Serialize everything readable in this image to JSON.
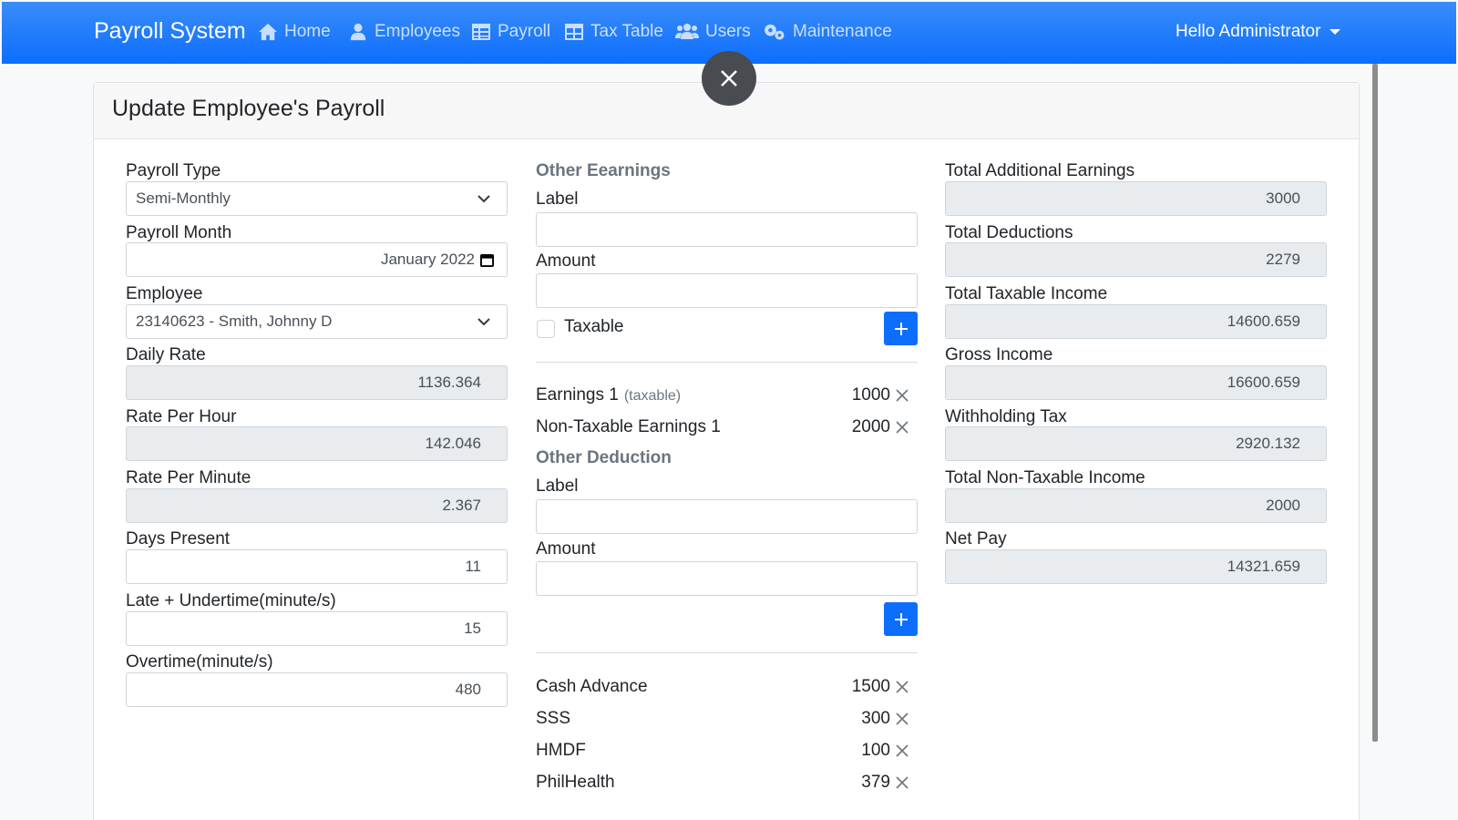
{
  "navbar": {
    "brand": "Payroll System",
    "items": [
      {
        "label": "Home",
        "icon": "home-icon"
      },
      {
        "label": "Employees",
        "icon": "user-icon"
      },
      {
        "label": "Payroll",
        "icon": "table-icon"
      },
      {
        "label": "Tax Table",
        "icon": "table-icon"
      },
      {
        "label": "Users",
        "icon": "users-icon"
      },
      {
        "label": "Maintenance",
        "icon": "gears-icon"
      }
    ],
    "user_greeting": "Hello Administrator"
  },
  "card": {
    "title": "Update Employee's Payroll"
  },
  "left": {
    "payroll_type": {
      "label": "Payroll Type",
      "value": "Semi-Monthly"
    },
    "payroll_month": {
      "label": "Payroll Month",
      "value": "January 2022"
    },
    "employee": {
      "label": "Employee",
      "value": "23140623 - Smith, Johnny D"
    },
    "daily_rate": {
      "label": "Daily Rate",
      "value": "1136.364"
    },
    "rate_per_hour": {
      "label": "Rate Per Hour",
      "value": "142.046"
    },
    "rate_per_minute": {
      "label": "Rate Per Minute",
      "value": "2.367"
    },
    "days_present": {
      "label": "Days Present",
      "value": "11"
    },
    "late_undertime": {
      "label": "Late + Undertime(minute/s)",
      "value": "15"
    },
    "overtime": {
      "label": "Overtime(minute/s)",
      "value": "480"
    }
  },
  "middle": {
    "earnings": {
      "heading": "Other Eearnings",
      "label_label": "Label",
      "amount_label": "Amount",
      "taxable_label": "Taxable",
      "items": [
        {
          "label": "Earnings 1",
          "tag": "(taxable)",
          "amount": "1000"
        },
        {
          "label": "Non-Taxable Earnings 1",
          "tag": "",
          "amount": "2000"
        }
      ]
    },
    "deductions": {
      "heading": "Other Deduction",
      "label_label": "Label",
      "amount_label": "Amount",
      "items": [
        {
          "label": "Cash Advance",
          "amount": "1500"
        },
        {
          "label": "SSS",
          "amount": "300"
        },
        {
          "label": "HMDF",
          "amount": "100"
        },
        {
          "label": "PhilHealth",
          "amount": "379"
        }
      ]
    }
  },
  "right": {
    "total_additional_earnings": {
      "label": "Total Additional Earnings",
      "value": "3000"
    },
    "total_deductions": {
      "label": "Total Deductions",
      "value": "2279"
    },
    "total_taxable_income": {
      "label": "Total Taxable Income",
      "value": "14600.659"
    },
    "gross_income": {
      "label": "Gross Income",
      "value": "16600.659"
    },
    "withholding_tax": {
      "label": "Withholding Tax",
      "value": "2920.132"
    },
    "total_non_taxable_income": {
      "label": "Total Non-Taxable Income",
      "value": "2000"
    },
    "net_pay": {
      "label": "Net Pay",
      "value": "14321.659"
    }
  },
  "colors": {
    "navbar": "#0d6efd",
    "primary_button": "#0d6efd",
    "close_button": "#484b50"
  }
}
